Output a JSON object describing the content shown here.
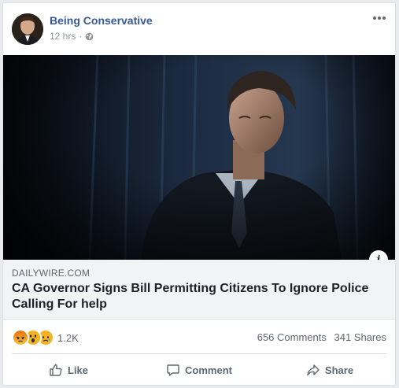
{
  "post": {
    "page_name": "Being Conservative",
    "time": "12 hrs",
    "separator": "·",
    "icons": {
      "audience": "globe-icon",
      "menu": "more-options-icon"
    }
  },
  "link": {
    "domain": "DAILYWIRE.COM",
    "headline": "CA Governor Signs Bill Permitting Citizens To Ignore Police Calling For help",
    "info_icon": "i"
  },
  "stats": {
    "reactions": [
      "angry",
      "wow",
      "sad"
    ],
    "reaction_count": "1.2K",
    "comments": "656 Comments",
    "shares": "341 Shares"
  },
  "actions": {
    "like": "Like",
    "comment": "Comment",
    "share": "Share"
  },
  "colors": {
    "page_name": "#385898",
    "angry": "#e9710f",
    "wow": "#f7b125",
    "sad": "#f7b125"
  }
}
